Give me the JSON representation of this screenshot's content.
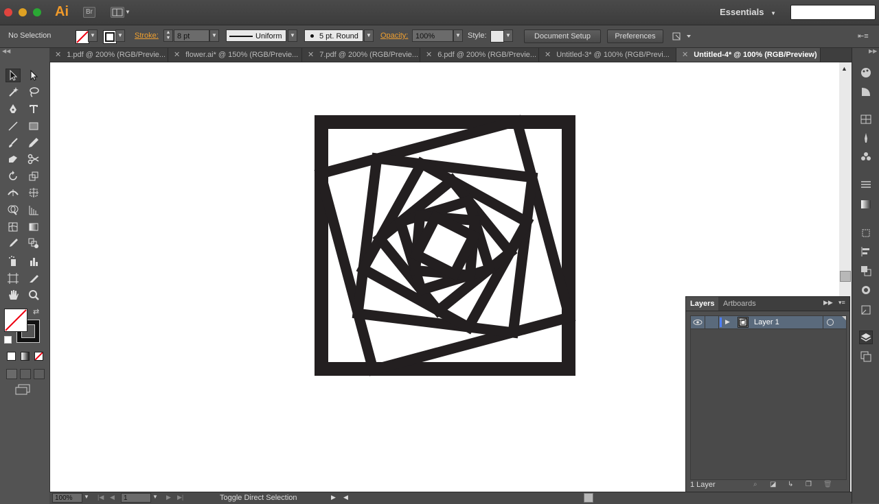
{
  "app": {
    "logo": "Ai",
    "bridge": "Br",
    "workspace": "Essentials"
  },
  "control_bar": {
    "selection": "No Selection",
    "stroke_label": "Stroke:",
    "stroke_value": "8 pt",
    "profile": "Uniform",
    "brush": "5 pt. Round",
    "opacity_label": "Opacity:",
    "opacity_value": "100%",
    "style_label": "Style:",
    "document_setup": "Document Setup",
    "preferences": "Preferences"
  },
  "tabs": [
    {
      "label": "1.pdf @ 200% (RGB/Previe..."
    },
    {
      "label": "flower.ai* @ 150% (RGB/Previe..."
    },
    {
      "label": "7.pdf @ 200% (RGB/Previe..."
    },
    {
      "label": "6.pdf @ 200% (RGB/Previe..."
    },
    {
      "label": "Untitled-3* @ 100% (RGB/Previ..."
    },
    {
      "label": "Untitled-4* @ 100% (RGB/Preview)"
    }
  ],
  "layers_panel": {
    "tabs": [
      "Layers",
      "Artboards"
    ],
    "layer_name": "Layer 1",
    "footer": "1 Layer"
  },
  "status_bar": {
    "zoom": "100%",
    "artboard": "1",
    "message": "Toggle Direct Selection"
  },
  "colors": {
    "accent": "#f0a030",
    "artwork": "#231f20",
    "canvas": "#ffffff"
  }
}
